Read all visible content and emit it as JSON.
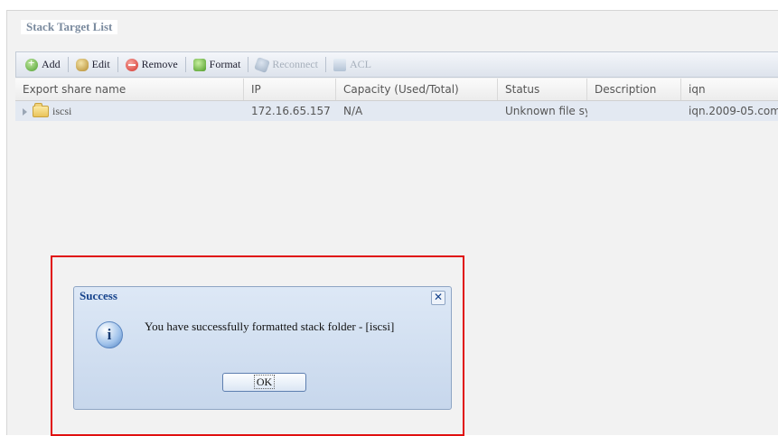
{
  "panel": {
    "legend": "Stack Target List"
  },
  "toolbar": {
    "add": "Add",
    "edit": "Edit",
    "remove": "Remove",
    "format": "Format",
    "reconnect": "Reconnect",
    "acl": "ACL"
  },
  "grid": {
    "columns": [
      "Export share name",
      "IP",
      "Capacity (Used/Total)",
      "Status",
      "Description",
      "iqn"
    ],
    "rows": [
      {
        "name": "iscsi",
        "ip": "172.16.65.157",
        "capacity": "N/A",
        "status": "Unknown file sy",
        "description": "",
        "iqn": "iqn.2009-05.com"
      }
    ]
  },
  "dialog": {
    "title": "Success",
    "message": "You have successfully formatted stack folder - [iscsi]",
    "ok_label": "OK",
    "close_glyph": "✕",
    "info_glyph": "i"
  },
  "colors": {
    "highlight": "#e01010",
    "row_selected": "#e3e9f2",
    "title_blue": "#15428b"
  }
}
